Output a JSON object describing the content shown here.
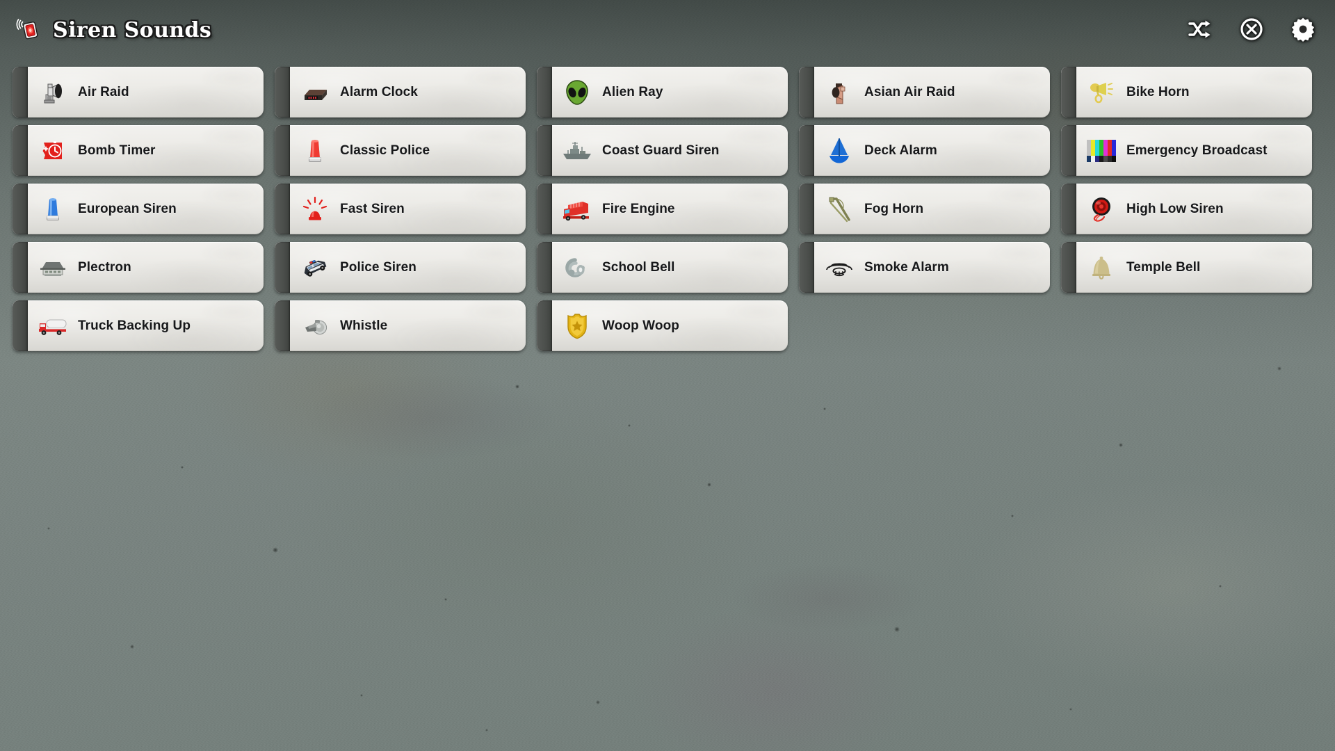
{
  "app": {
    "title": "Siren Sounds",
    "logo_icon": "siren-light-icon",
    "background": "concrete-texture",
    "colors": {
      "background": "#7d8884",
      "button_face": "#edece8",
      "button_grip": "#4c4f4c",
      "label_text": "#17181a",
      "title_text": "#ffffff",
      "title_outline": "#1b1b1b"
    }
  },
  "header": {
    "actions": [
      {
        "name": "shuffle-button",
        "icon": "shuffle-icon",
        "label": "Shuffle"
      },
      {
        "name": "close-button",
        "icon": "close-circle-icon",
        "label": "Close"
      },
      {
        "name": "settings-button",
        "icon": "gear-icon",
        "label": "Settings"
      }
    ]
  },
  "sounds": [
    {
      "label": "Air Raid",
      "icon": "air-raid-siren-icon"
    },
    {
      "label": "Alarm Clock",
      "icon": "alarm-clock-icon"
    },
    {
      "label": "Alien Ray",
      "icon": "alien-head-icon"
    },
    {
      "label": "Asian Air Raid",
      "icon": "loudspeaker-icon"
    },
    {
      "label": "Bike Horn",
      "icon": "postal-horn-icon"
    },
    {
      "label": "Bomb Timer",
      "icon": "timer-clock-icon"
    },
    {
      "label": "Classic Police",
      "icon": "police-light-red-icon"
    },
    {
      "label": "Coast Guard Siren",
      "icon": "warship-icon"
    },
    {
      "label": "Deck Alarm",
      "icon": "sailboat-icon"
    },
    {
      "label": "Emergency Broadcast",
      "icon": "color-bars-icon"
    },
    {
      "label": "European Siren",
      "icon": "police-light-blue-icon"
    },
    {
      "label": "Fast Siren",
      "icon": "flashing-light-icon"
    },
    {
      "label": "Fire Engine",
      "icon": "fire-engine-icon"
    },
    {
      "label": "Fog Horn",
      "icon": "fog-horn-icon"
    },
    {
      "label": "High Low Siren",
      "icon": "round-siren-speaker-icon"
    },
    {
      "label": "Plectron",
      "icon": "plectron-radio-icon"
    },
    {
      "label": "Police Siren",
      "icon": "police-car-icon"
    },
    {
      "label": "School Bell",
      "icon": "school-bell-spiral-icon"
    },
    {
      "label": "Smoke Alarm",
      "icon": "smoke-detector-icon"
    },
    {
      "label": "Temple Bell",
      "icon": "temple-bell-icon"
    },
    {
      "label": "Truck Backing Up",
      "icon": "truck-icon"
    },
    {
      "label": "Whistle",
      "icon": "whistle-icon"
    },
    {
      "label": "Woop Woop",
      "icon": "police-badge-icon"
    }
  ]
}
